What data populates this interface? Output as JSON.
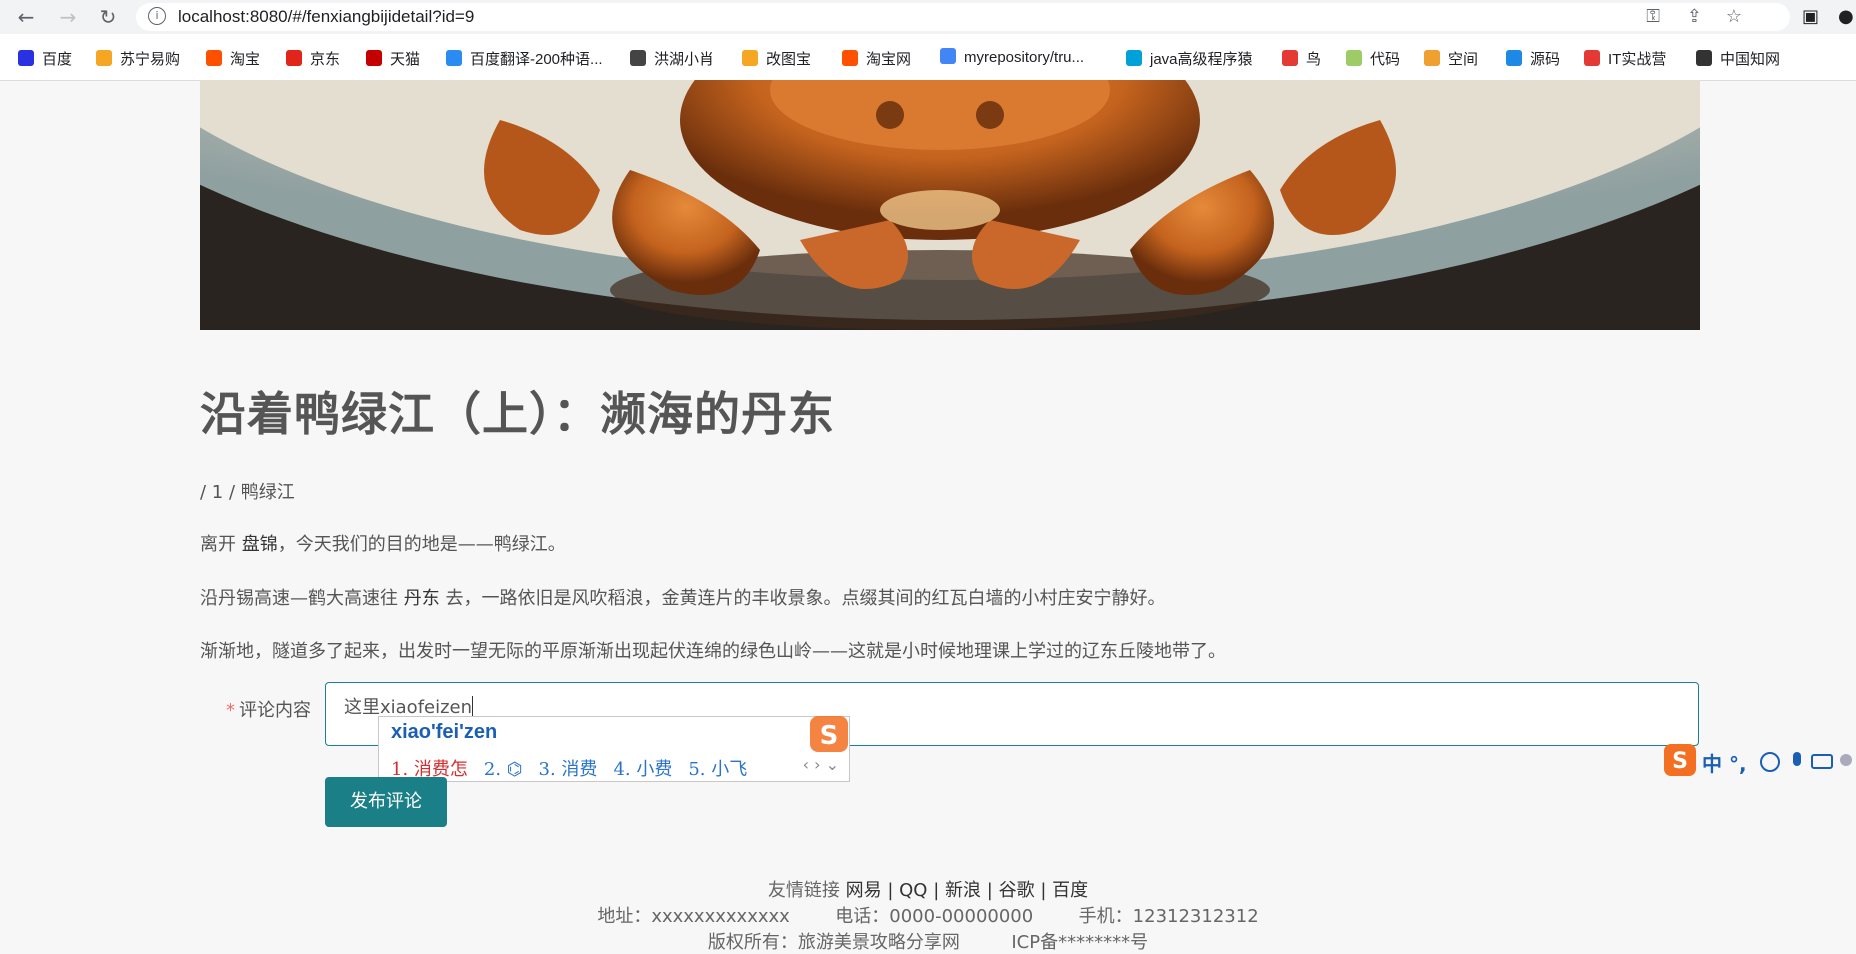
{
  "browser": {
    "url": "localhost:8080/#/fenxiangbijidetail?id=9"
  },
  "bookmarks": [
    {
      "label": "百度",
      "icon": "baidu-paw-icon",
      "color": "#2932e1"
    },
    {
      "label": "苏宁易购",
      "icon": "suning-icon",
      "color": "#f5a623"
    },
    {
      "label": "淘宝",
      "icon": "taobao-icon",
      "color": "#ff5000"
    },
    {
      "label": "京东",
      "icon": "jd-icon",
      "color": "#e1251b"
    },
    {
      "label": "天猫",
      "icon": "tmall-icon",
      "color": "#c40000"
    },
    {
      "label": "百度翻译-200种语...",
      "icon": "translate-icon",
      "color": "#2a8cf0"
    },
    {
      "label": "洪湖小肖",
      "icon": "bird-icon",
      "color": "#444444"
    },
    {
      "label": "改图宝",
      "icon": "gaitubao-icon",
      "color": "#f5a623"
    },
    {
      "label": "淘宝网",
      "icon": "taobao-net-icon",
      "color": "#ff5000"
    },
    {
      "label": "myrepository/tru...",
      "icon": "chrome-icon",
      "color": "#4285f4"
    },
    {
      "label": "java高级程序猿",
      "icon": "bilibili-icon",
      "color": "#00a1d6"
    },
    {
      "label": "鸟",
      "icon": "bird-red-icon",
      "color": "#e53935"
    },
    {
      "label": "代码",
      "icon": "code-icon",
      "color": "#9ccc65"
    },
    {
      "label": "空间",
      "icon": "qzone-icon",
      "color": "#f0a030"
    },
    {
      "label": "源码",
      "icon": "fish-icon",
      "color": "#1e88e5"
    },
    {
      "label": "IT实战营",
      "icon": "it-icon",
      "color": "#e53935"
    },
    {
      "label": "中国知网",
      "icon": "cnki-icon",
      "color": "#333333"
    }
  ],
  "article": {
    "title": "沿着鸭绿江（上）：濒海的丹东",
    "crumb": "/ 1 / 鸭绿江",
    "p1_a": "离开 ",
    "p1_b": "盘锦",
    "p1_c": "，今天我们的目的地是——鸭绿江。",
    "p2_a": "沿丹锡高速—鹤大高速往 ",
    "p2_b": "丹东",
    "p2_c": " 去，一路依旧是风吹稻浪，金黄连片的丰收景象。点缀其间的红瓦白墙的小村庄安宁静好。",
    "p3": "渐渐地，隧道多了起来，出发时一望无际的平原渐渐出现起伏连绵的绿色山岭——这就是小时候地理课上学过的辽东丘陵地带了。"
  },
  "comment": {
    "star": "*",
    "label": "评论内容",
    "value": "这里xiaofeizen",
    "submit": "发布评论"
  },
  "ime": {
    "pinyin": "xiao'fei'zen",
    "candidates": [
      "1. 消费怎",
      "2. ⌬",
      "3. 消费",
      "4. 小费",
      "5. 小飞"
    ],
    "arrows": "‹ › ⌄",
    "bar_text": "中 °,"
  },
  "footer": {
    "friend_label": "友情链接",
    "links": [
      "网易",
      "QQ",
      "新浪",
      "谷歌",
      "百度"
    ],
    "sep": "|",
    "address": "地址：xxxxxxxxxxxxx",
    "phone": "电话：0000-00000000",
    "mobile": "手机：12312312312",
    "copyright": "版权所有：旅游美景攻略分享网",
    "icp": "ICP备********号"
  },
  "colors": {
    "accent": "#1a7f86",
    "required": "#f56c6c"
  }
}
